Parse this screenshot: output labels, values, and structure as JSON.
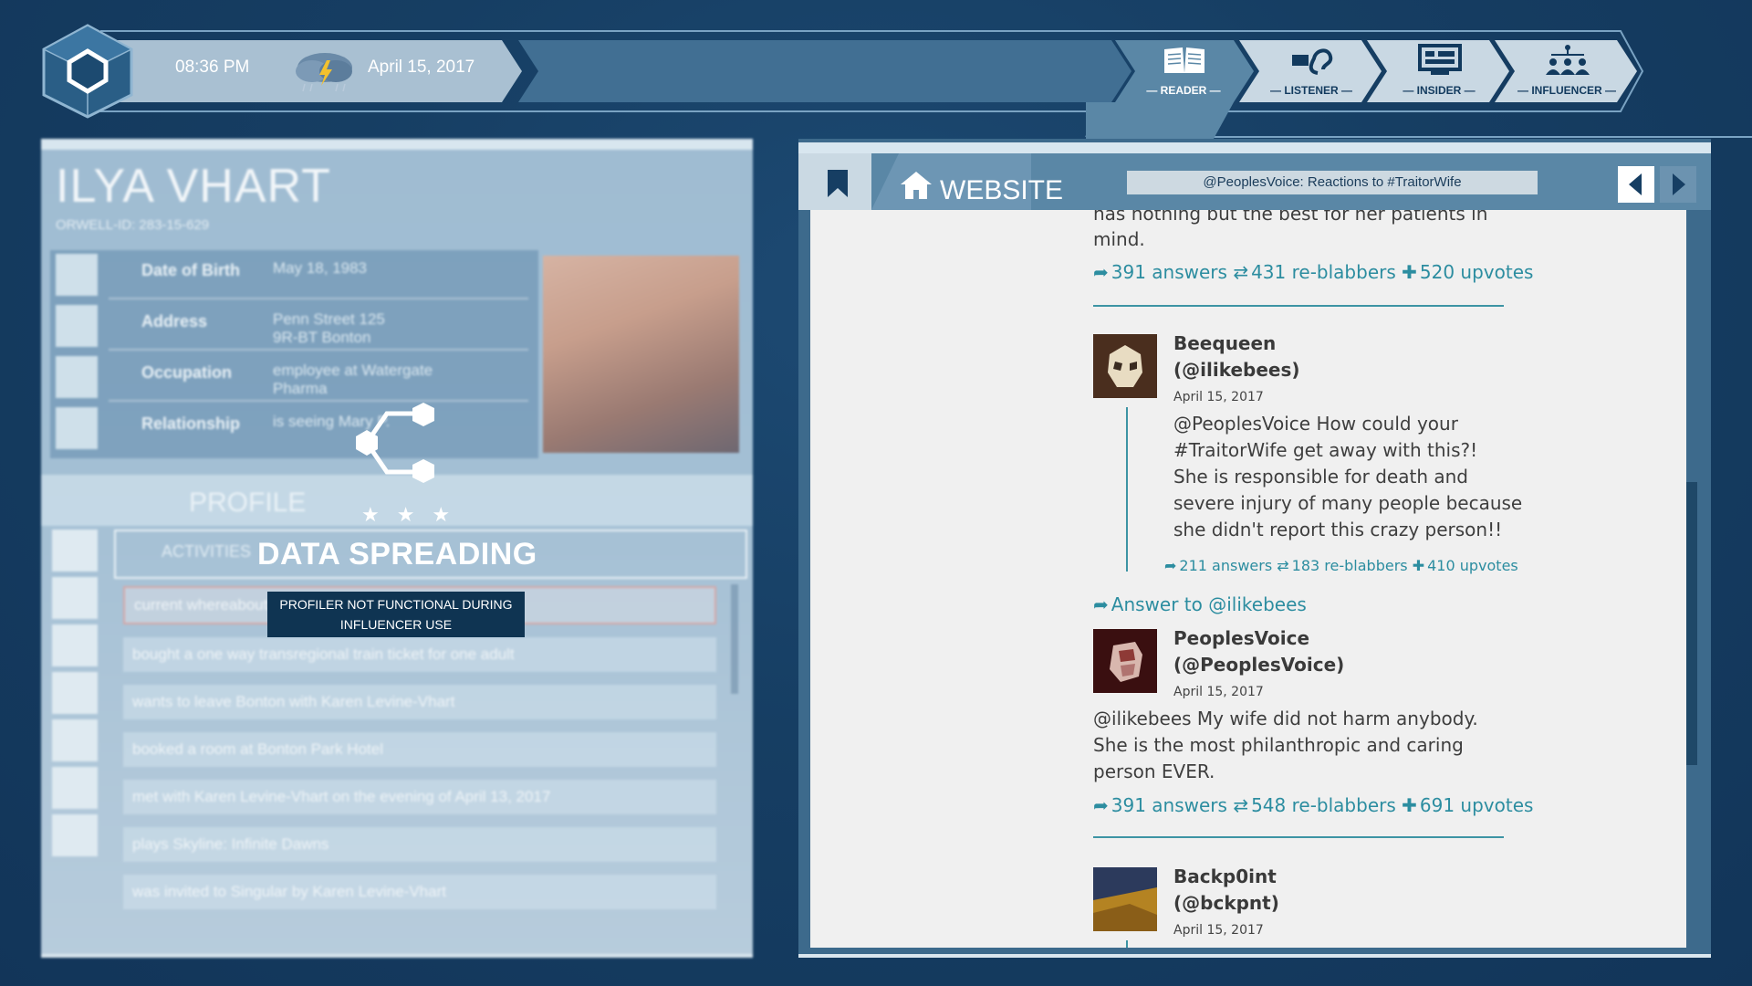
{
  "topbar": {
    "time": "08:36 PM",
    "date": "April 15, 2017",
    "weather_icon": "storm-cloud-icon",
    "roles": [
      {
        "label": "— READER —",
        "icon": "book-icon",
        "active": true
      },
      {
        "label": "— LISTENER —",
        "icon": "ear-icon",
        "active": false
      },
      {
        "label": "— INSIDER —",
        "icon": "monitor-icon",
        "active": false
      },
      {
        "label": "— INFLUENCER —",
        "icon": "network-icon",
        "active": false
      }
    ]
  },
  "profile": {
    "name": "ILYA VHART",
    "orwell_id": "ORWELL-ID: 283-15-629",
    "fields": [
      {
        "label": "Date of Birth",
        "value": "May 18, 1983"
      },
      {
        "label": "Address",
        "value": "Penn Street 125\n9R-BT Bonton"
      },
      {
        "label": "Occupation",
        "value": "employee at Watergate\nPharma"
      },
      {
        "label": "Relationship",
        "value": "is seeing Mary P."
      }
    ],
    "tab_label": "PROFILE",
    "section_label": "ACTIVITIES",
    "activities": [
      "current whereabouts",
      "bought a one way transregional train ticket for one adult",
      "wants to leave Bonton with Karen Levine-Vhart",
      "booked a room at Bonton Park Hotel",
      "met with Karen Levine-Vhart on the evening of April 13, 2017",
      "plays Skyline: Infinite Dawns",
      "was invited to Singular by Karen Levine-Vhart"
    ]
  },
  "overlay": {
    "stars": "★ ★ ★",
    "title": "DATA SPREADING",
    "warning": "PROFILER NOT FUNCTIONAL DURING INFLUENCER USE"
  },
  "browser": {
    "tab_label": "WEBSITE",
    "url": "@PeoplesVoice: Reactions to #TraitorWife",
    "post0": {
      "text_tail_1": "has nothing but the best for her patients in",
      "text_tail_2": "mind.",
      "answers": "391 answers",
      "reblabbers": "431 re-blabbers",
      "upvotes": "520 upvotes"
    },
    "post1": {
      "name": "Beequeen",
      "handle": "(@ilikebees)",
      "date": "April 15, 2017",
      "lines": [
        "@PeoplesVoice How could your",
        "#TraitorWife get away with this?!",
        "She is responsible for death and",
        "severe injury of many people because",
        "she didn't report this crazy person!!"
      ],
      "answers": "211 answers",
      "reblabbers": "183 re-blabbers",
      "upvotes": "410 upvotes"
    },
    "answer_link": "Answer to @ilikebees",
    "post2": {
      "name": "PeoplesVoice",
      "handle": "(@PeoplesVoice)",
      "date": "April 15, 2017",
      "lines": [
        "@ilikebees My wife did not harm anybody.",
        "She is the most philanthropic and caring",
        "person EVER."
      ],
      "answers": "391 answers",
      "reblabbers": "548 re-blabbers",
      "upvotes": "691 upvotes"
    },
    "post3": {
      "name": "Backp0int",
      "handle": "(@bckpnt)",
      "date": "April 15, 2017"
    }
  },
  "colors": {
    "background": "#163e63",
    "accent": "#2c8da0",
    "panel": "#3d6a8c"
  }
}
